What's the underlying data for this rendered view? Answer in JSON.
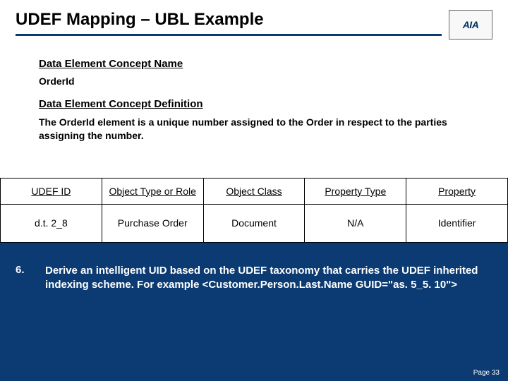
{
  "header": {
    "title": "UDEF Mapping – UBL Example",
    "logo_main": "AIA"
  },
  "section": {
    "decn_label": "Data Element Concept Name",
    "decn_value": "OrderId",
    "decd_label": "Data Element Concept Definition",
    "decd_value": "The OrderId element is a unique number assigned to the Order in respect to the parties assigning the number."
  },
  "table": {
    "headers": [
      "UDEF ID",
      "Object Type or Role",
      "Object Class",
      "Property Type",
      "Property"
    ],
    "row": [
      "d.t. 2_8",
      "Purchase Order",
      "Document",
      "N/A",
      "Identifier"
    ]
  },
  "step": {
    "number": "6.",
    "text": "Derive an intelligent UID based on the UDEF taxonomy that carries the UDEF inherited indexing scheme. For example <Customer.Person.Last.Name GUID=\"as. 5_5. 10\">"
  },
  "footer": {
    "page": "Page 33"
  }
}
